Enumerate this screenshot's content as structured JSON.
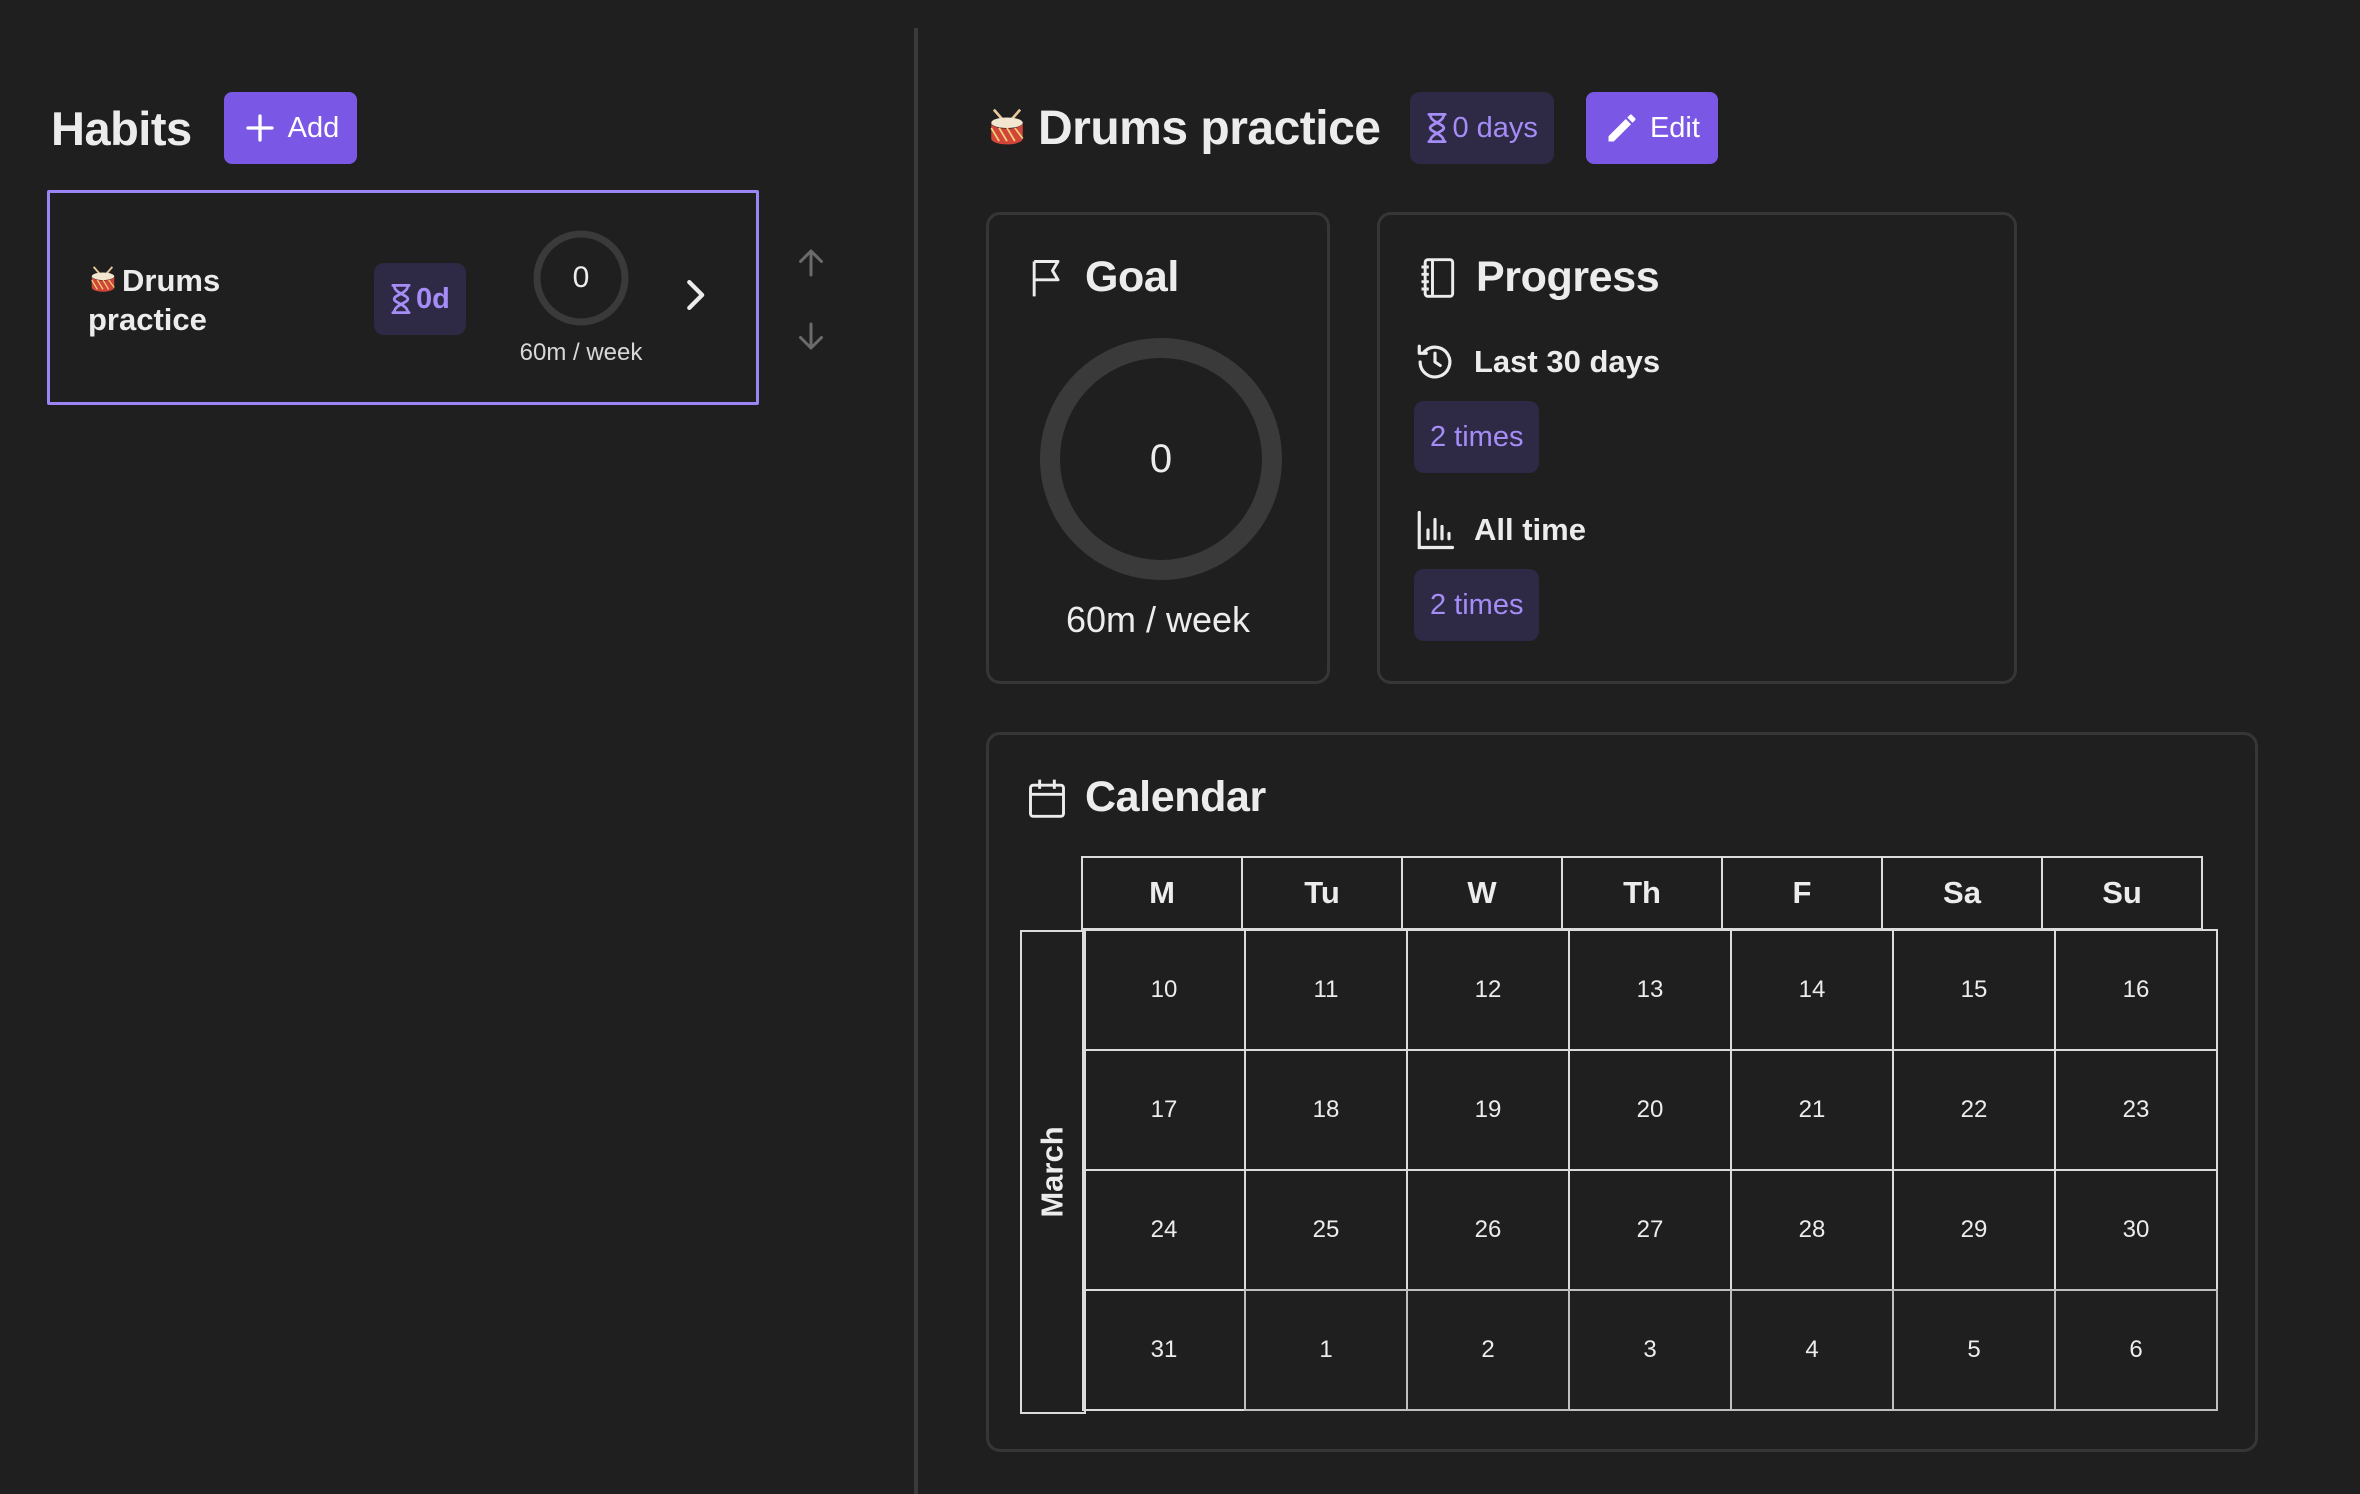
{
  "sidebar": {
    "title": "Habits",
    "add_label": "Add",
    "habits": [
      {
        "name": "Drums practice",
        "emoji_icon": "drum-emoji",
        "streak": "0d",
        "progress_value": "0",
        "goal": "60m / week",
        "progress_fraction": 0
      }
    ]
  },
  "detail": {
    "title": "Drums practice",
    "emoji_icon": "drum-emoji",
    "streak": "0 days",
    "edit_label": "Edit",
    "goal": {
      "title": "Goal",
      "value": "0",
      "label": "60m / week",
      "progress_fraction": 0
    },
    "progress": {
      "title": "Progress",
      "last30_label": "Last 30 days",
      "last30_value": "2 times",
      "alltime_label": "All time",
      "alltime_value": "2 times"
    },
    "calendar": {
      "title": "Calendar",
      "month": "March",
      "weekdays": [
        "M",
        "Tu",
        "W",
        "Th",
        "F",
        "Sa",
        "Su"
      ],
      "weeks": [
        [
          "10",
          "11",
          "12",
          "13",
          "14",
          "15",
          "16"
        ],
        [
          "17",
          "18",
          "19",
          "20",
          "21",
          "22",
          "23"
        ],
        [
          "24",
          "25",
          "26",
          "27",
          "28",
          "29",
          "30"
        ],
        [
          "31",
          "1",
          "2",
          "3",
          "4",
          "5",
          "6"
        ]
      ]
    }
  },
  "colors": {
    "background": "#1f1f1f",
    "accent": "#7b57e6",
    "badge_bg": "#2e2a45",
    "badge_text": "#a58cf7",
    "selected_border": "#9b85f5"
  }
}
